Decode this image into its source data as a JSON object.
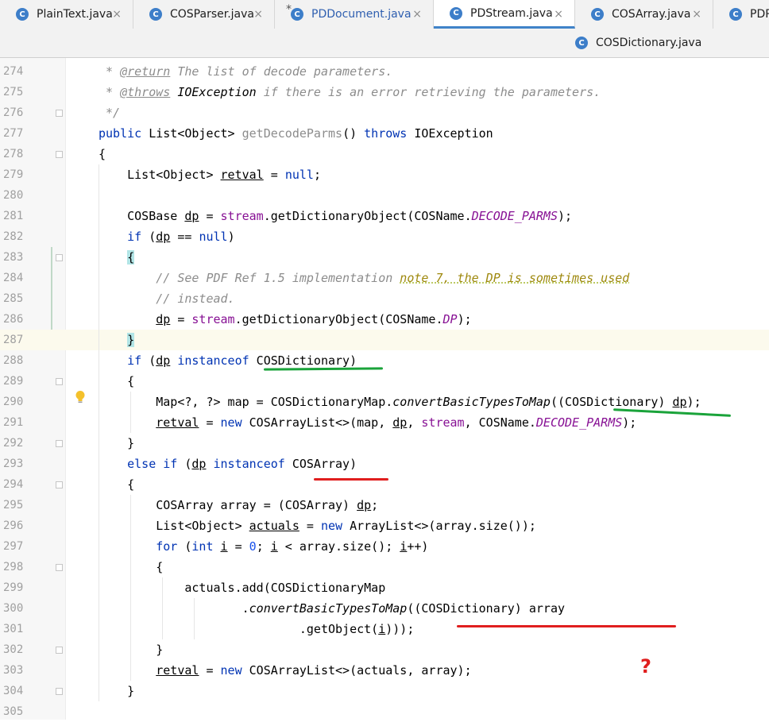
{
  "tabs": {
    "row1": [
      {
        "label": "PlainText.java",
        "icon": "java-class-icon"
      },
      {
        "label": "COSParser.java",
        "icon": "java-class-icon"
      },
      {
        "label": "PDDocument.java",
        "icon": "java-class-icon",
        "modified_mark": "*"
      },
      {
        "label": "PDStream.java",
        "icon": "java-class-icon",
        "active": true
      },
      {
        "label": "COSArray.java",
        "icon": "java-class-icon"
      },
      {
        "label": "PDP",
        "icon": "java-class-icon"
      }
    ],
    "row2": [
      {
        "label": "COSDictionary.java",
        "icon": "java-class-icon"
      }
    ],
    "close_glyph": "×",
    "file_icon_letter": "C"
  },
  "editor": {
    "current_line": 287,
    "lines": [
      {
        "n": "274",
        "t": [
          [
            " * ",
            "cm"
          ],
          [
            "@return",
            "tag"
          ],
          [
            " The list of decode parameters.",
            "cm"
          ]
        ]
      },
      {
        "n": "275",
        "t": [
          [
            " * ",
            "cm"
          ],
          [
            "@throws",
            "tag"
          ],
          [
            " ",
            "cm"
          ],
          [
            "IOException",
            "cmr"
          ],
          [
            " if there is an error retrieving the parameters.",
            "cm"
          ]
        ]
      },
      {
        "n": "276",
        "t": [
          [
            " */",
            "cm"
          ]
        ]
      },
      {
        "n": "277",
        "t": [
          [
            "public",
            "kw"
          ],
          [
            " List<Object> ",
            ""
          ],
          [
            "getDecodeParms",
            "unused"
          ],
          [
            "() ",
            ""
          ],
          [
            "throws",
            "kw"
          ],
          [
            " IOException",
            ""
          ]
        ]
      },
      {
        "n": "278",
        "t": [
          [
            "{",
            ""
          ]
        ]
      },
      {
        "n": "279",
        "t": [
          [
            "    List<Object> ",
            ""
          ],
          [
            "retval",
            "uline"
          ],
          [
            " = ",
            ""
          ],
          [
            "null",
            "kw"
          ],
          [
            ";",
            ""
          ]
        ]
      },
      {
        "n": "280",
        "t": []
      },
      {
        "n": "281",
        "t": [
          [
            "    COSBase ",
            ""
          ],
          [
            "dp",
            "uline"
          ],
          [
            " = ",
            ""
          ],
          [
            "stream",
            "fld"
          ],
          [
            ".getDictionaryObject(COSName.",
            ""
          ],
          [
            "DECODE_PARMS",
            "sfld"
          ],
          [
            ");",
            ""
          ]
        ]
      },
      {
        "n": "282",
        "t": [
          [
            "    ",
            ""
          ],
          [
            "if",
            "kw"
          ],
          [
            " (",
            ""
          ],
          [
            "dp",
            "uline"
          ],
          [
            " == ",
            ""
          ],
          [
            "null",
            "kw"
          ],
          [
            ")",
            ""
          ]
        ]
      },
      {
        "n": "283",
        "t": [
          [
            "    ",
            ""
          ],
          [
            "{",
            "brace-hl"
          ]
        ]
      },
      {
        "n": "284",
        "t": [
          [
            "        // See PDF Ref 1.5 implementation ",
            "cm"
          ],
          [
            "note 7, the DP is sometimes used",
            "todo"
          ]
        ]
      },
      {
        "n": "285",
        "t": [
          [
            "        // instead.",
            "cm"
          ]
        ]
      },
      {
        "n": "286",
        "t": [
          [
            "        ",
            ""
          ],
          [
            "dp",
            "uline"
          ],
          [
            " = ",
            ""
          ],
          [
            "stream",
            "fld"
          ],
          [
            ".getDictionaryObject(COSName.",
            ""
          ],
          [
            "DP",
            "sfld"
          ],
          [
            ");",
            ""
          ]
        ]
      },
      {
        "n": "287",
        "t": [
          [
            "    ",
            ""
          ],
          [
            "}",
            "brace-hl"
          ]
        ]
      },
      {
        "n": "288",
        "t": [
          [
            "    ",
            ""
          ],
          [
            "if",
            "kw"
          ],
          [
            " (",
            ""
          ],
          [
            "dp",
            "uline"
          ],
          [
            " ",
            ""
          ],
          [
            "instanceof",
            "kw"
          ],
          [
            " COSDictionary)",
            ""
          ]
        ]
      },
      {
        "n": "289",
        "t": [
          [
            "    {",
            ""
          ]
        ]
      },
      {
        "n": "290",
        "t": [
          [
            "        Map<?, ?> map = COSDictionaryMap.",
            ""
          ],
          [
            "convertBasicTypesToMap",
            "mth"
          ],
          [
            "((COSDictionary) ",
            ""
          ],
          [
            "dp",
            "uline"
          ],
          [
            ");",
            ""
          ]
        ]
      },
      {
        "n": "291",
        "t": [
          [
            "        ",
            ""
          ],
          [
            "retval",
            "uline"
          ],
          [
            " = ",
            ""
          ],
          [
            "new",
            "kw"
          ],
          [
            " COSArrayList<>(map, ",
            ""
          ],
          [
            "dp",
            "uline"
          ],
          [
            ", ",
            ""
          ],
          [
            "stream",
            "fld"
          ],
          [
            ", COSName.",
            ""
          ],
          [
            "DECODE_PARMS",
            "sfld"
          ],
          [
            ");",
            ""
          ]
        ]
      },
      {
        "n": "292",
        "t": [
          [
            "    }",
            ""
          ]
        ]
      },
      {
        "n": "293",
        "t": [
          [
            "    ",
            ""
          ],
          [
            "else if",
            "kw"
          ],
          [
            " (",
            ""
          ],
          [
            "dp",
            "uline"
          ],
          [
            " ",
            ""
          ],
          [
            "instanceof",
            "kw"
          ],
          [
            " COSArray)",
            ""
          ]
        ]
      },
      {
        "n": "294",
        "t": [
          [
            "    {",
            ""
          ]
        ]
      },
      {
        "n": "295",
        "t": [
          [
            "        COSArray array = (COSArray) ",
            ""
          ],
          [
            "dp",
            "uline"
          ],
          [
            ";",
            ""
          ]
        ]
      },
      {
        "n": "296",
        "t": [
          [
            "        List<Object> ",
            ""
          ],
          [
            "actuals",
            "uline"
          ],
          [
            " = ",
            ""
          ],
          [
            "new",
            "kw"
          ],
          [
            " ArrayList<>(array.size());",
            ""
          ]
        ]
      },
      {
        "n": "297",
        "t": [
          [
            "        ",
            ""
          ],
          [
            "for",
            "kw"
          ],
          [
            " (",
            ""
          ],
          [
            "int",
            "kw"
          ],
          [
            " ",
            ""
          ],
          [
            "i",
            "uline"
          ],
          [
            " = ",
            ""
          ],
          [
            "0",
            "num"
          ],
          [
            "; ",
            ""
          ],
          [
            "i",
            "uline"
          ],
          [
            " < array.size(); ",
            ""
          ],
          [
            "i",
            "uline"
          ],
          [
            "++)",
            ""
          ]
        ]
      },
      {
        "n": "298",
        "t": [
          [
            "        {",
            ""
          ]
        ]
      },
      {
        "n": "299",
        "t": [
          [
            "            actuals.add(COSDictionaryMap",
            ""
          ]
        ]
      },
      {
        "n": "300",
        "t": [
          [
            "                    .",
            ""
          ],
          [
            "convertBasicTypesToMap",
            "mth"
          ],
          [
            "((COSDictionary) array",
            ""
          ]
        ]
      },
      {
        "n": "301",
        "t": [
          [
            "                            .getObject(",
            ""
          ],
          [
            "i",
            "uline"
          ],
          [
            ")));",
            ""
          ]
        ]
      },
      {
        "n": "302",
        "t": [
          [
            "        }",
            ""
          ]
        ]
      },
      {
        "n": "303",
        "t": [
          [
            "        ",
            ""
          ],
          [
            "retval",
            "uline"
          ],
          [
            " = ",
            ""
          ],
          [
            "new",
            "kw"
          ],
          [
            " COSArrayList<>(actuals, array);",
            ""
          ]
        ]
      },
      {
        "n": "304",
        "t": [
          [
            "    }",
            ""
          ]
        ]
      },
      {
        "n": "305",
        "t": []
      }
    ]
  },
  "annotations": {
    "question_mark": "?",
    "green_color": "#1aa33a",
    "red_color": "#e01e1e"
  }
}
